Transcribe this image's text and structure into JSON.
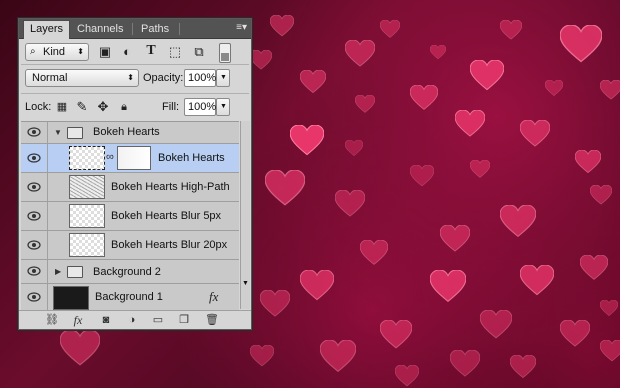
{
  "tabs": [
    {
      "label": "Layers",
      "active": true
    },
    {
      "label": "Channels",
      "active": false
    },
    {
      "label": "Paths",
      "active": false
    }
  ],
  "panel_menu_icon": "panel-menu-icon",
  "filter": {
    "kind_label": "Kind"
  },
  "blend": {
    "mode": "Normal",
    "opacity_label": "Opacity:",
    "opacity_value": "100%"
  },
  "lock": {
    "label": "Lock:",
    "fill_label": "Fill:",
    "fill_value": "100%"
  },
  "layers": [
    {
      "name": "Bokeh Hearts",
      "type": "group",
      "expanded": true
    },
    {
      "name": "Bokeh Hearts",
      "type": "layer-with-mask",
      "selected": true
    },
    {
      "name": "Bokeh Hearts High-Path",
      "type": "layer"
    },
    {
      "name": "Bokeh Hearts Blur 5px",
      "type": "layer"
    },
    {
      "name": "Bokeh Hearts Blur 20px",
      "type": "layer"
    },
    {
      "name": "Background 2",
      "type": "group",
      "expanded": false
    },
    {
      "name": "Background 1",
      "type": "layer",
      "fx": "fx"
    }
  ],
  "footer_icons": [
    "link-icon",
    "fx-icon",
    "mask-icon",
    "adjustment-icon",
    "folder-icon",
    "new-layer-icon",
    "trash-icon"
  ],
  "colors": {
    "selected_row": "#b8cff3",
    "panel_bg": "#d6d6d6",
    "tab_bar": "#535353",
    "heart": "#e8356a"
  }
}
